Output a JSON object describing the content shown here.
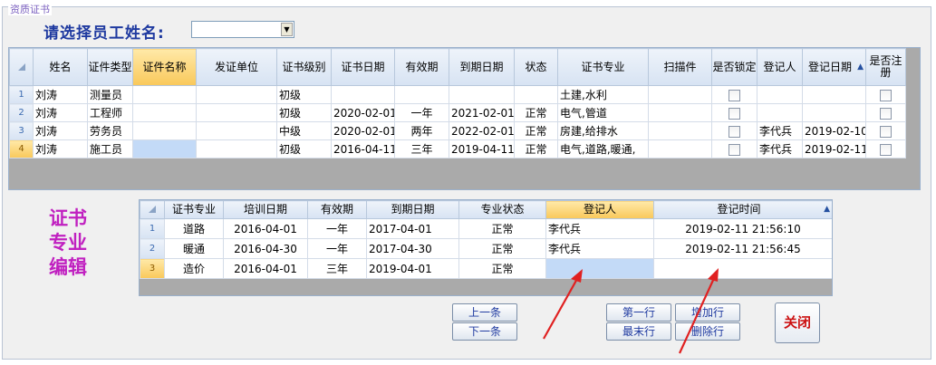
{
  "window": {
    "title": "资质证书"
  },
  "selector": {
    "label": "请选择员工姓名:",
    "value": ""
  },
  "cert_grid": {
    "columns": [
      "姓名",
      "证件类型",
      "证件名称",
      "发证单位",
      "证书级别",
      "证书日期",
      "有效期",
      "到期日期",
      "状态",
      "证书专业",
      "扫描件",
      "是否锁定",
      "登记人",
      "登记日期",
      "是否注册"
    ],
    "rows": [
      {
        "num": "1",
        "name": "刘涛",
        "type": "测量员",
        "cert_name": "",
        "issuer": "",
        "level": "初级",
        "cert_date": "",
        "validity": "",
        "expiry": "",
        "status": "",
        "major": "土建,水利",
        "scan": "",
        "locked": false,
        "registrar": "",
        "reg_date": "",
        "registered": false
      },
      {
        "num": "2",
        "name": "刘涛",
        "type": "工程师",
        "cert_name": "",
        "issuer": "",
        "level": "初级",
        "cert_date": "2020-02-01",
        "validity": "一年",
        "expiry": "2021-02-01",
        "status": "正常",
        "major": "电气,管道",
        "scan": "",
        "locked": false,
        "registrar": "",
        "reg_date": "",
        "registered": false
      },
      {
        "num": "3",
        "name": "刘涛",
        "type": "劳务员",
        "cert_name": "",
        "issuer": "",
        "level": "中级",
        "cert_date": "2020-02-01",
        "validity": "两年",
        "expiry": "2022-02-01",
        "status": "正常",
        "major": "房建,给排水",
        "scan": "",
        "locked": false,
        "registrar": "李代兵",
        "reg_date": "2019-02-10",
        "registered": false
      },
      {
        "num": "4",
        "name": "刘涛",
        "type": "施工员",
        "cert_name": "",
        "issuer": "",
        "level": "初级",
        "cert_date": "2016-04-11",
        "validity": "三年",
        "expiry": "2019-04-11",
        "status": "正常",
        "major": "电气,道路,暖通,",
        "scan": "",
        "locked": false,
        "registrar": "李代兵",
        "reg_date": "2019-02-11",
        "registered": false
      }
    ]
  },
  "side_label": {
    "line1": "证书",
    "line2": "专业",
    "line3": "编辑"
  },
  "major_grid": {
    "columns": [
      "证书专业",
      "培训日期",
      "有效期",
      "到期日期",
      "专业状态",
      "登记人",
      "登记时间"
    ],
    "rows": [
      {
        "num": "1",
        "major": "道路",
        "train_date": "2016-04-01",
        "validity": "一年",
        "expiry": "2017-04-01",
        "status": "正常",
        "registrar": "李代兵",
        "reg_time": "2019-02-11 21:56:10"
      },
      {
        "num": "2",
        "major": "暖通",
        "train_date": "2016-04-30",
        "validity": "一年",
        "expiry": "2017-04-30",
        "status": "正常",
        "registrar": "李代兵",
        "reg_time": "2019-02-11 21:56:45"
      },
      {
        "num": "3",
        "major": "造价",
        "train_date": "2016-04-01",
        "validity": "三年",
        "expiry": "2019-04-01",
        "status": "正常",
        "registrar": "",
        "reg_time": ""
      }
    ]
  },
  "buttons": {
    "prev": "上一条",
    "next": "下一条",
    "first": "第一行",
    "last": "最末行",
    "add": "增加行",
    "delete": "删除行",
    "close": "关闭"
  },
  "colors": {
    "title_blue": "#1f3aa0",
    "side_magenta": "#c020c0",
    "close_red": "#cc1111",
    "arrow_red": "#e02020"
  }
}
